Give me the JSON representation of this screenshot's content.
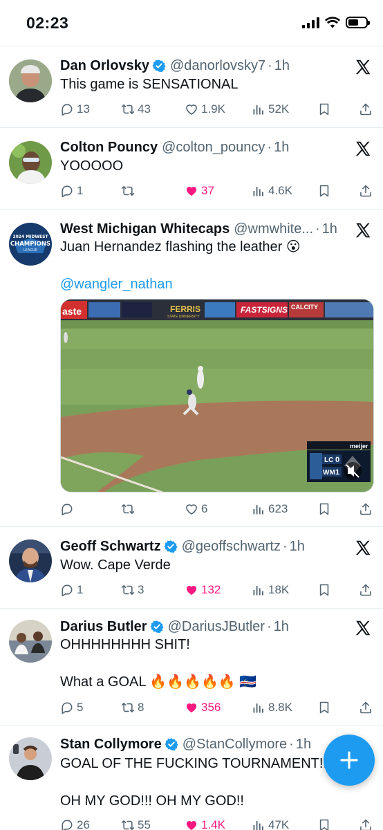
{
  "status_bar": {
    "time": "02:23",
    "battery_level": 0.6
  },
  "tweets": [
    {
      "name": "Dan Orlovsky",
      "verified": true,
      "handle": "@danorlovsky7",
      "time": "1h",
      "text": "This game is SENSATIONAL",
      "replies": "13",
      "retweets": "43",
      "likes": "1.9K",
      "views": "52K",
      "liked": false
    },
    {
      "name": "Colton Pouncy",
      "verified": false,
      "handle": "@colton_pouncy",
      "time": "1h",
      "text": "YOOOOO",
      "replies": "1",
      "retweets": "",
      "likes": "37",
      "views": "4.6K",
      "liked": true
    },
    {
      "name": "West Michigan Whitecaps",
      "verified": false,
      "handle": "@wmwhite...",
      "time": "1h",
      "text": "Juan Hernandez flashing the leather 😮",
      "mention": "@wangler_nathan",
      "replies": "",
      "retweets": "",
      "likes": "6",
      "views": "623",
      "liked": false,
      "avatar_text": {
        "top": "2024 MIDWEST",
        "main": "CHAMPIONS",
        "sub": "LEAGUE"
      },
      "media": {
        "ad_banners": [
          "aste",
          "FERRIS",
          "STATE UNIVERSITY",
          "FASTSIGNS",
          "CALCITY"
        ],
        "scoreboard": {
          "team1": "LC",
          "score1": "0",
          "team2": "WM",
          "score2": "1",
          "sponsor": "meijer"
        }
      }
    },
    {
      "name": "Geoff Schwartz",
      "verified": true,
      "handle": "@geoffschwartz",
      "time": "1h",
      "text": "Wow. Cape Verde",
      "replies": "1",
      "retweets": "3",
      "likes": "132",
      "views": "18K",
      "liked": true
    },
    {
      "name": "Darius Butler",
      "verified": true,
      "handle": "@DariusJButler",
      "time": "1h",
      "text": "OHHHHHHHH SHIT!",
      "text2": "What a GOAL 🔥🔥🔥🔥🔥 🇨🇻",
      "replies": "5",
      "retweets": "8",
      "likes": "356",
      "views": "8.8K",
      "liked": true
    },
    {
      "name": "Stan Collymore",
      "verified": true,
      "handle": "@StanCollymore",
      "time": "1h",
      "text": "GOAL OF THE FUCKING TOURNAMENT!...",
      "text2": "OH MY GOD!!! OH MY GOD!!",
      "replies": "26",
      "retweets": "55",
      "likes": "1.4K",
      "views": "47K",
      "liked": true
    }
  ],
  "colors": {
    "accent": "#1d9bf0",
    "like": "#f91880",
    "muted": "#536471",
    "text": "#0f1419"
  },
  "icons": [
    "signal-icon",
    "wifi-icon",
    "battery-icon",
    "verified-icon",
    "x-logo-icon",
    "reply-icon",
    "retweet-icon",
    "like-icon",
    "views-icon",
    "bookmark-icon",
    "share-icon",
    "compose-plus-icon"
  ]
}
